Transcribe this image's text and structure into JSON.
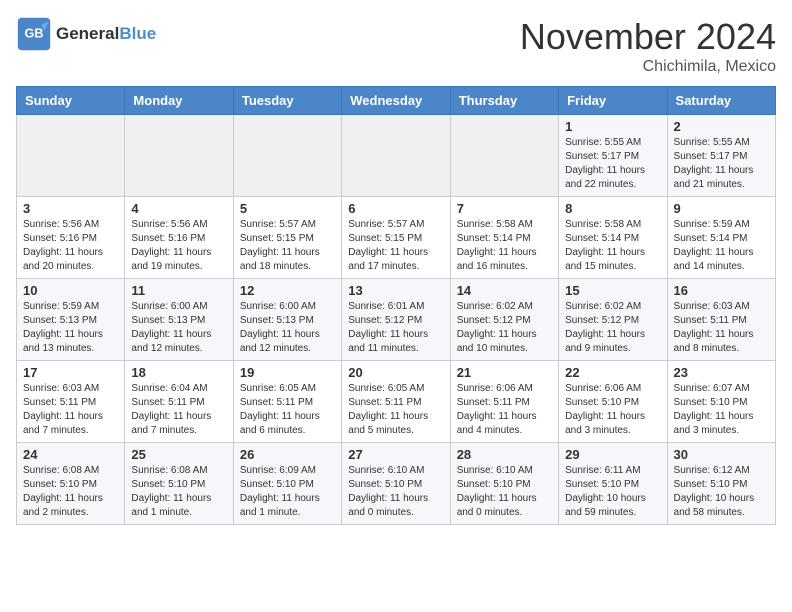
{
  "header": {
    "logo_line1": "General",
    "logo_line2": "Blue",
    "month": "November 2024",
    "location": "Chichimila, Mexico"
  },
  "weekdays": [
    "Sunday",
    "Monday",
    "Tuesday",
    "Wednesday",
    "Thursday",
    "Friday",
    "Saturday"
  ],
  "weeks": [
    [
      {
        "day": "",
        "info": ""
      },
      {
        "day": "",
        "info": ""
      },
      {
        "day": "",
        "info": ""
      },
      {
        "day": "",
        "info": ""
      },
      {
        "day": "",
        "info": ""
      },
      {
        "day": "1",
        "info": "Sunrise: 5:55 AM\nSunset: 5:17 PM\nDaylight: 11 hours\nand 22 minutes."
      },
      {
        "day": "2",
        "info": "Sunrise: 5:55 AM\nSunset: 5:17 PM\nDaylight: 11 hours\nand 21 minutes."
      }
    ],
    [
      {
        "day": "3",
        "info": "Sunrise: 5:56 AM\nSunset: 5:16 PM\nDaylight: 11 hours\nand 20 minutes."
      },
      {
        "day": "4",
        "info": "Sunrise: 5:56 AM\nSunset: 5:16 PM\nDaylight: 11 hours\nand 19 minutes."
      },
      {
        "day": "5",
        "info": "Sunrise: 5:57 AM\nSunset: 5:15 PM\nDaylight: 11 hours\nand 18 minutes."
      },
      {
        "day": "6",
        "info": "Sunrise: 5:57 AM\nSunset: 5:15 PM\nDaylight: 11 hours\nand 17 minutes."
      },
      {
        "day": "7",
        "info": "Sunrise: 5:58 AM\nSunset: 5:14 PM\nDaylight: 11 hours\nand 16 minutes."
      },
      {
        "day": "8",
        "info": "Sunrise: 5:58 AM\nSunset: 5:14 PM\nDaylight: 11 hours\nand 15 minutes."
      },
      {
        "day": "9",
        "info": "Sunrise: 5:59 AM\nSunset: 5:14 PM\nDaylight: 11 hours\nand 14 minutes."
      }
    ],
    [
      {
        "day": "10",
        "info": "Sunrise: 5:59 AM\nSunset: 5:13 PM\nDaylight: 11 hours\nand 13 minutes."
      },
      {
        "day": "11",
        "info": "Sunrise: 6:00 AM\nSunset: 5:13 PM\nDaylight: 11 hours\nand 12 minutes."
      },
      {
        "day": "12",
        "info": "Sunrise: 6:00 AM\nSunset: 5:13 PM\nDaylight: 11 hours\nand 12 minutes."
      },
      {
        "day": "13",
        "info": "Sunrise: 6:01 AM\nSunset: 5:12 PM\nDaylight: 11 hours\nand 11 minutes."
      },
      {
        "day": "14",
        "info": "Sunrise: 6:02 AM\nSunset: 5:12 PM\nDaylight: 11 hours\nand 10 minutes."
      },
      {
        "day": "15",
        "info": "Sunrise: 6:02 AM\nSunset: 5:12 PM\nDaylight: 11 hours\nand 9 minutes."
      },
      {
        "day": "16",
        "info": "Sunrise: 6:03 AM\nSunset: 5:11 PM\nDaylight: 11 hours\nand 8 minutes."
      }
    ],
    [
      {
        "day": "17",
        "info": "Sunrise: 6:03 AM\nSunset: 5:11 PM\nDaylight: 11 hours\nand 7 minutes."
      },
      {
        "day": "18",
        "info": "Sunrise: 6:04 AM\nSunset: 5:11 PM\nDaylight: 11 hours\nand 7 minutes."
      },
      {
        "day": "19",
        "info": "Sunrise: 6:05 AM\nSunset: 5:11 PM\nDaylight: 11 hours\nand 6 minutes."
      },
      {
        "day": "20",
        "info": "Sunrise: 6:05 AM\nSunset: 5:11 PM\nDaylight: 11 hours\nand 5 minutes."
      },
      {
        "day": "21",
        "info": "Sunrise: 6:06 AM\nSunset: 5:11 PM\nDaylight: 11 hours\nand 4 minutes."
      },
      {
        "day": "22",
        "info": "Sunrise: 6:06 AM\nSunset: 5:10 PM\nDaylight: 11 hours\nand 3 minutes."
      },
      {
        "day": "23",
        "info": "Sunrise: 6:07 AM\nSunset: 5:10 PM\nDaylight: 11 hours\nand 3 minutes."
      }
    ],
    [
      {
        "day": "24",
        "info": "Sunrise: 6:08 AM\nSunset: 5:10 PM\nDaylight: 11 hours\nand 2 minutes."
      },
      {
        "day": "25",
        "info": "Sunrise: 6:08 AM\nSunset: 5:10 PM\nDaylight: 11 hours\nand 1 minute."
      },
      {
        "day": "26",
        "info": "Sunrise: 6:09 AM\nSunset: 5:10 PM\nDaylight: 11 hours\nand 1 minute."
      },
      {
        "day": "27",
        "info": "Sunrise: 6:10 AM\nSunset: 5:10 PM\nDaylight: 11 hours\nand 0 minutes."
      },
      {
        "day": "28",
        "info": "Sunrise: 6:10 AM\nSunset: 5:10 PM\nDaylight: 11 hours\nand 0 minutes."
      },
      {
        "day": "29",
        "info": "Sunrise: 6:11 AM\nSunset: 5:10 PM\nDaylight: 10 hours\nand 59 minutes."
      },
      {
        "day": "30",
        "info": "Sunrise: 6:12 AM\nSunset: 5:10 PM\nDaylight: 10 hours\nand 58 minutes."
      }
    ]
  ]
}
